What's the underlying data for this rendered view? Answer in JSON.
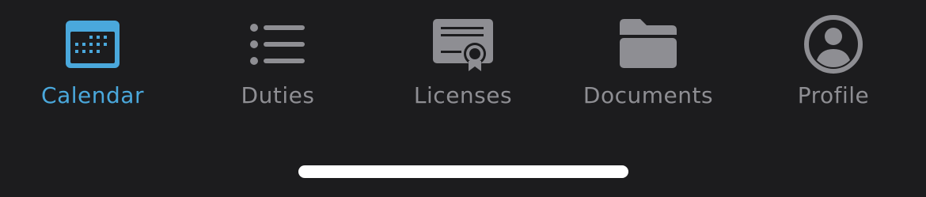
{
  "tab_bar": {
    "active_tab": "calendar",
    "accent_color": "#4aa8dc",
    "inactive_color": "#8e8e93",
    "background_color": "#1c1c1e",
    "tabs": [
      {
        "id": "calendar",
        "label": "Calendar",
        "icon": "calendar-icon"
      },
      {
        "id": "duties",
        "label": "Duties",
        "icon": "list-icon"
      },
      {
        "id": "licenses",
        "label": "Licenses",
        "icon": "certificate-icon"
      },
      {
        "id": "documents",
        "label": "Documents",
        "icon": "folder-icon"
      },
      {
        "id": "profile",
        "label": "Profile",
        "icon": "person-circle-icon"
      }
    ]
  }
}
